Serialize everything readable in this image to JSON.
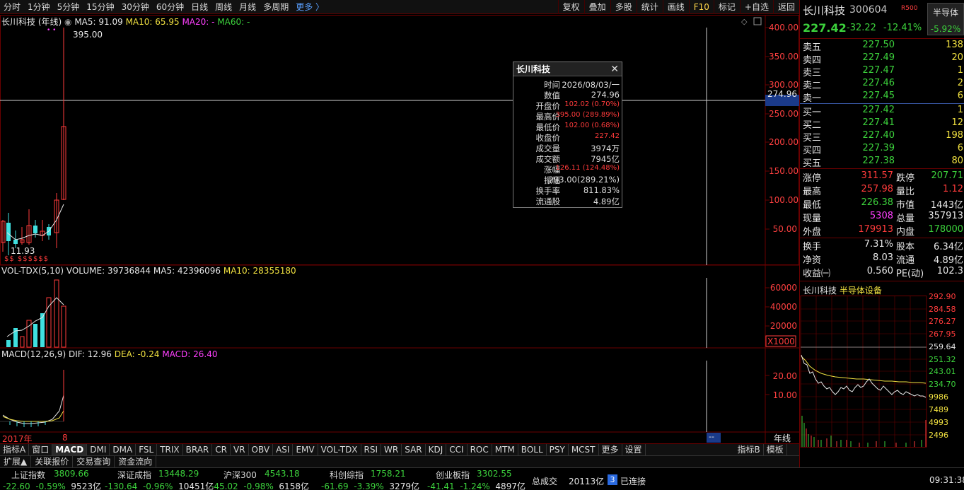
{
  "toolbar": {
    "periods": [
      "分时",
      "1分钟",
      "5分钟",
      "15分钟",
      "30分钟",
      "60分钟",
      "日线",
      "周线",
      "月线",
      "多周期",
      "更多 〉"
    ],
    "tools": [
      "复权",
      "叠加",
      "多股",
      "统计",
      "画线",
      "F10",
      "标记",
      "+自选",
      "返回"
    ]
  },
  "main_chart": {
    "title": "长川科技 (年线)",
    "ma5": "MA5: 91.09",
    "ma10": "MA10: 65.95",
    "ma20": "MA20: -",
    "ma60": "MA60: -",
    "high_label": "395.00",
    "low_label": "11.93",
    "cursor_value": "274.96",
    "y_ticks": [
      "400.00",
      "350.00",
      "300.00",
      "250.00",
      "200.00",
      "150.00",
      "100.00",
      "50.00"
    ]
  },
  "volume_chart": {
    "title": "VOL-TDX(5,10)",
    "volume": "VOLUME: 39736844",
    "ma5": "MA5: 42396096",
    "ma10": "MA10: 28355180",
    "y_ticks": [
      "60000",
      "40000",
      "20000"
    ],
    "unit": "X1000"
  },
  "macd_chart": {
    "title": "MACD(12,26,9)",
    "dif": "DIF: 12.96",
    "dea": "DEA: -0.24",
    "macd": "MACD: 26.40",
    "y_ticks": [
      "20.00",
      "10.00"
    ]
  },
  "x_axis": {
    "start": "2017年",
    "tick": "8",
    "cursor_tag": "--",
    "period_tag": "年线"
  },
  "tooltip": {
    "title": "长川科技",
    "rows": [
      {
        "k": "时间",
        "v": "2026/08/03/一",
        "c": "white"
      },
      {
        "k": "数值",
        "v": "274.96",
        "c": "white"
      },
      {
        "k": "开盘价",
        "v": "102.02 (0.70%)",
        "c": "red"
      },
      {
        "k": "最高价",
        "v": "395.00 (289.89%)",
        "c": "red"
      },
      {
        "k": "最低价",
        "v": "102.00 (0.68%)",
        "c": "red"
      },
      {
        "k": "收盘价",
        "v": "227.42",
        "c": "red"
      },
      {
        "k": "成交量",
        "v": "3974万",
        "c": "white"
      },
      {
        "k": "成交额",
        "v": "7945亿",
        "c": "white"
      },
      {
        "k": "涨幅",
        "v": "126.11 (124.48%)",
        "c": "red"
      },
      {
        "k": "振幅",
        "v": "293.00(289.21%)",
        "c": "white"
      },
      {
        "k": "换手率",
        "v": "811.83%",
        "c": "white"
      },
      {
        "k": "流通股",
        "v": "4.89亿",
        "c": "white"
      }
    ]
  },
  "quote": {
    "name": "长川科技",
    "code": "300604",
    "tag": "R500",
    "sector": "半导体",
    "sector_pct": "-5.92%",
    "price": "227.42",
    "change": "-32.22",
    "pct": "-12.41%",
    "asks": [
      {
        "label": "卖五",
        "price": "227.50",
        "vol": "138"
      },
      {
        "label": "卖四",
        "price": "227.49",
        "vol": "20"
      },
      {
        "label": "卖三",
        "price": "227.47",
        "vol": "1"
      },
      {
        "label": "卖二",
        "price": "227.46",
        "vol": "2"
      },
      {
        "label": "卖一",
        "price": "227.45",
        "vol": "6"
      }
    ],
    "bids": [
      {
        "label": "买一",
        "price": "227.42",
        "vol": "1"
      },
      {
        "label": "买二",
        "price": "227.41",
        "vol": "12"
      },
      {
        "label": "买三",
        "price": "227.40",
        "vol": "198"
      },
      {
        "label": "买四",
        "price": "227.39",
        "vol": "6"
      },
      {
        "label": "买五",
        "price": "227.38",
        "vol": "80"
      }
    ],
    "stats1": [
      {
        "k1": "涨停",
        "v1": "311.57",
        "c1": "red",
        "k2": "跌停",
        "v2": "207.71",
        "c2": "green"
      },
      {
        "k1": "最高",
        "v1": "257.98",
        "c1": "red",
        "k2": "量比",
        "v2": "1.12",
        "c2": "red"
      },
      {
        "k1": "最低",
        "v1": "226.38",
        "c1": "green",
        "k2": "市值",
        "v2": "1443亿",
        "c2": "white"
      },
      {
        "k1": "现量",
        "v1": "5308",
        "c1": "magenta",
        "k2": "总量",
        "v2": "357913",
        "c2": "white"
      },
      {
        "k1": "外盘",
        "v1": "179913",
        "c1": "red",
        "k2": "内盘",
        "v2": "178000",
        "c2": "green"
      }
    ],
    "stats2": [
      {
        "k1": "换手",
        "v1": "7.31%",
        "c1": "white",
        "k2": "股本",
        "v2": "6.34亿",
        "c2": "white"
      },
      {
        "k1": "净资",
        "v1": "8.03",
        "c1": "white",
        "k2": "流通",
        "v2": "4.89亿",
        "c2": "white"
      },
      {
        "k1": "收益㈠",
        "v1": "0.560",
        "c1": "white",
        "k2": "PE(动)",
        "v2": "102.3",
        "c2": "white"
      }
    ],
    "mini": {
      "name": "长川科技",
      "sector": "半导体设备",
      "price_ticks": [
        "292.90",
        "284.58",
        "276.27",
        "267.95",
        "259.64",
        "251.32",
        "243.01",
        "234.70",
        "9986",
        "7489",
        "4993",
        "2496"
      ]
    }
  },
  "indicator_tabs": [
    "指标A",
    "窗口",
    "MACD",
    "DMI",
    "DMA",
    "FSL",
    "TRIX",
    "BRAR",
    "CR",
    "VR",
    "OBV",
    "ASI",
    "EMV",
    "VOL-TDX",
    "RSI",
    "WR",
    "SAR",
    "KDJ",
    "CCI",
    "ROC",
    "MTM",
    "BOLL",
    "PSY",
    "MCST",
    "更多",
    "设置"
  ],
  "right_tabs": [
    "指标B",
    "模板"
  ],
  "func_tabs": [
    "扩展▲",
    "关联报价",
    "交易查询",
    "资金流向"
  ],
  "indices": [
    {
      "name": "上证指数",
      "value": "3809.66",
      "chg": "-22.60",
      "pct": "-0.59%",
      "amt": "9523亿"
    },
    {
      "name": "深证成指",
      "value": "13448.29",
      "chg": "-130.64",
      "pct": "-0.96%",
      "amt": "10451亿"
    },
    {
      "name": "沪深300",
      "value": "4543.18",
      "chg": "-45.02",
      "pct": "-0.98%",
      "amt": "6158亿"
    },
    {
      "name": "科创综指",
      "value": "1758.21",
      "chg": "-61.69",
      "pct": "-3.39%",
      "amt": "3279亿"
    },
    {
      "name": "创业板指",
      "value": "3302.55",
      "chg": "-41.41",
      "pct": "-1.24%",
      "amt": "4897亿"
    }
  ],
  "status": {
    "total_label": "总成交",
    "total_value": "20113亿",
    "conn_count": "3",
    "conn_label": "已连接",
    "time": "09:31:38"
  }
}
